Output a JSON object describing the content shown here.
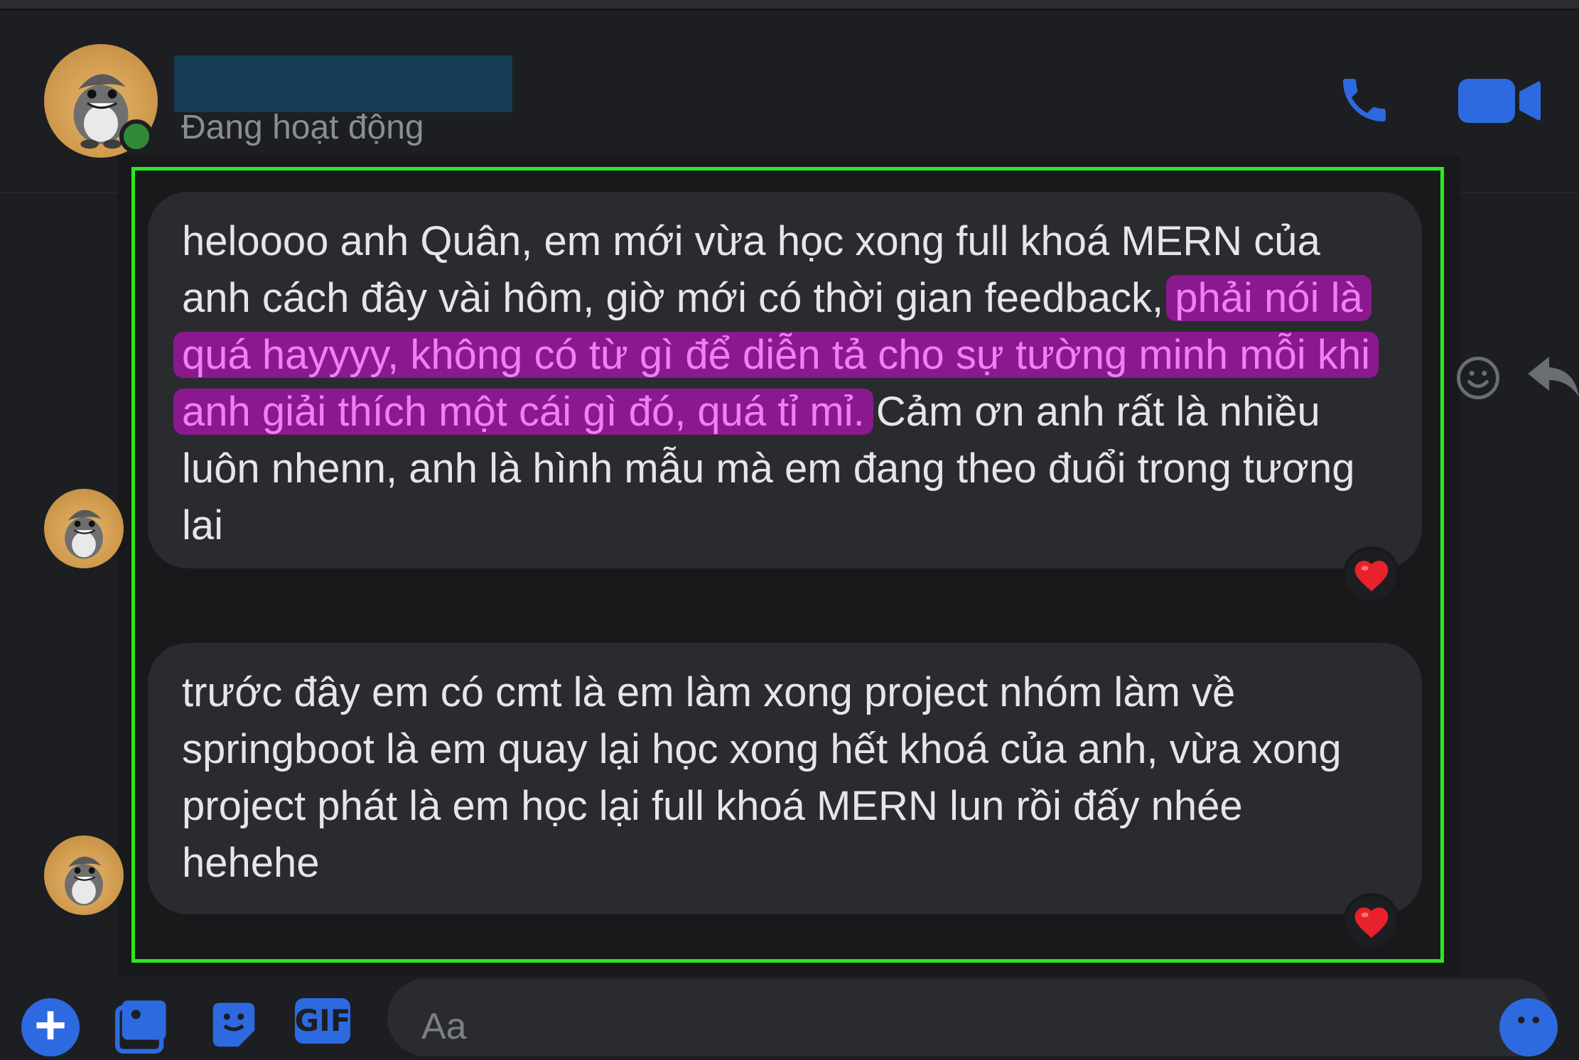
{
  "header": {
    "status": "Đang hoạt động"
  },
  "messages": [
    {
      "before_highlight": "heloooo anh Quân, em mới vừa học xong full khoá MERN của anh cách đây vài hôm, giờ mới có thời gian feedback, ",
      "highlight": "phải nói là quá hayyyy, không có từ gì để diễn tả cho sự tường minh mỗi khi anh giải thích một cái gì đó, quá tỉ mỉ.",
      "after_highlight": " Cảm ơn anh rất là nhiều luôn nhenn, anh là hình mẫu mà em đang theo đuổi trong tương lai",
      "reaction": "❤️"
    },
    {
      "text": "trước đây em có cmt là em làm xong project nhóm làm về springboot là em quay lại học xong hết khoá của anh, vừa xong project phát là em học lại full khoá MERN lun rồi đấy nhée hehehe",
      "reaction": "❤️"
    }
  ],
  "composer": {
    "placeholder": "Aa",
    "gif_label": "GIF",
    "plus_label": "+"
  },
  "colors": {
    "accent": "#2d6ae0",
    "highlight_bg": "#8a198f",
    "highlight_text": "#f07ef5",
    "frame": "#2be821",
    "online": "#2f8a3a"
  },
  "icons": [
    "phone-icon",
    "video-call-icon",
    "emoji-react-icon",
    "reply-icon",
    "plus-icon",
    "image-icon",
    "sticker-icon",
    "gif-icon",
    "emoji-icon"
  ]
}
